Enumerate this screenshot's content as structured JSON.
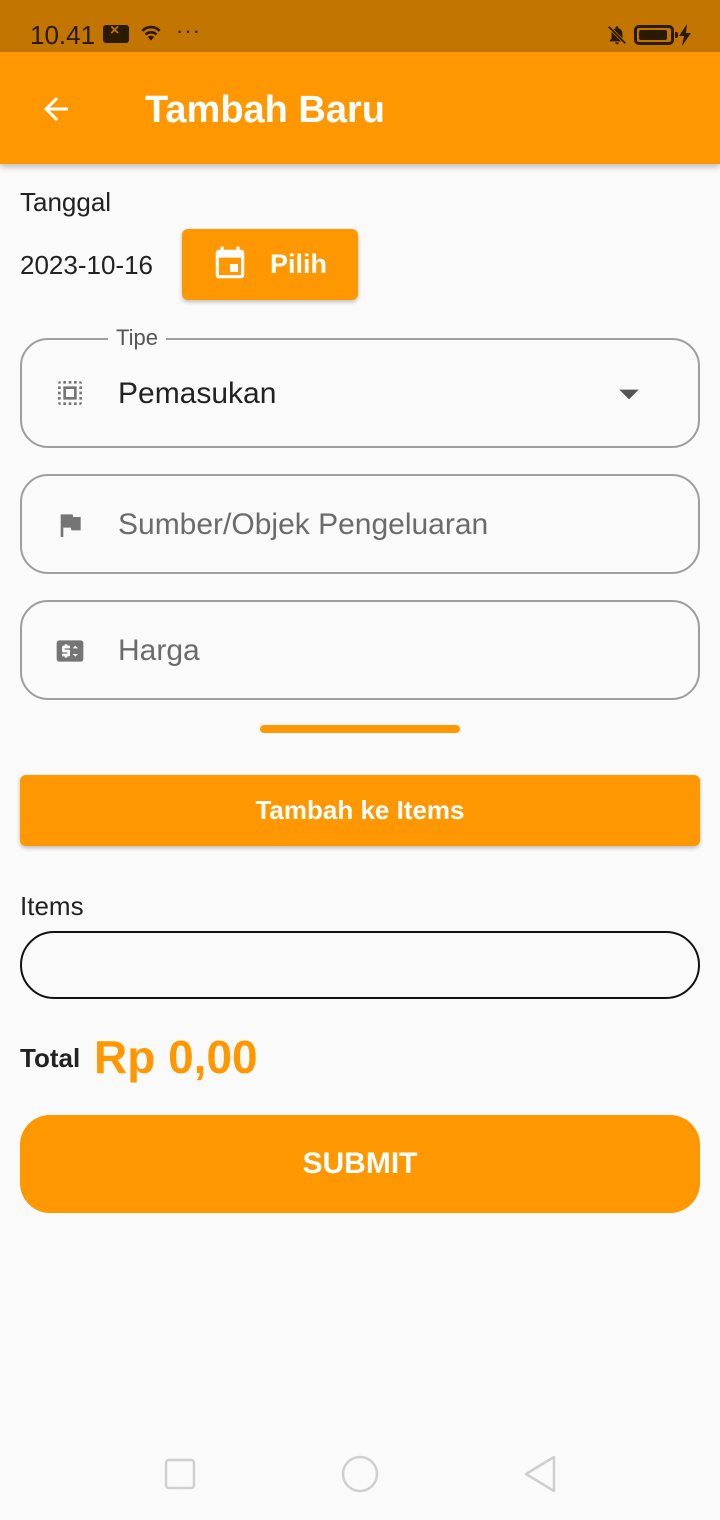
{
  "status_bar": {
    "time": "10.41",
    "icons": [
      "sim-error-icon",
      "wifi-icon",
      "more-dots-icon",
      "bell-off-icon",
      "battery-icon",
      "charging-bolt-icon"
    ],
    "dots": "···"
  },
  "app_bar": {
    "title": "Tambah Baru",
    "back_icon": "arrow-back-icon"
  },
  "form": {
    "date_label": "Tanggal",
    "date_value": "2023-10-16",
    "pick_button_label": "Pilih",
    "pick_button_icon": "calendar-icon",
    "tipe": {
      "legend": "Tipe",
      "selected": "Pemasukan",
      "icon": "select-all-icon",
      "dropdown_icon": "dropdown-arrow-icon"
    },
    "source": {
      "placeholder": "Sumber/Objek Pengeluaran",
      "icon": "flag-icon"
    },
    "price": {
      "placeholder": "Harga",
      "icon": "price-change-icon"
    },
    "add_button_label": "Tambah ke Items",
    "items_label": "Items",
    "total_label": "Total",
    "total_value": "Rp 0,00",
    "submit_label": "SUBMIT"
  },
  "nav_bar": {
    "icons": [
      "recent-apps-icon",
      "home-icon",
      "back-icon"
    ]
  },
  "colors": {
    "accent": "#ff9800",
    "status_bar": "#c27500",
    "background": "#fafafa"
  }
}
